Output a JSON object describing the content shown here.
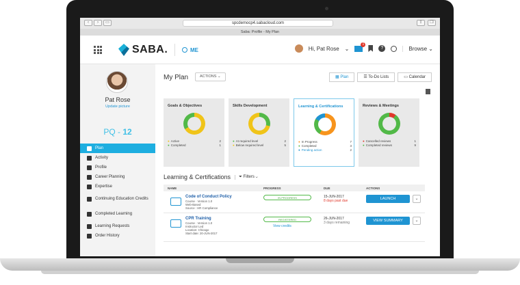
{
  "browser": {
    "url": "spcdemocp4.sabacloud.com",
    "tab_title": "Saba: Profile - My Plan"
  },
  "header": {
    "logo_text": "SABA.",
    "me_label": "ME",
    "greeting": "Hi, Pat Rose",
    "mail_count": "1",
    "browse_label": "Browse"
  },
  "sidebar": {
    "user_name": "Pat Rose",
    "update_picture": "Update picture",
    "pq_label": "PQ - ",
    "pq_value": "12",
    "items": [
      {
        "label": "Plan"
      },
      {
        "label": "Activity"
      },
      {
        "label": "Profile"
      },
      {
        "label": "Career Planning"
      },
      {
        "label": "Expertise"
      },
      {
        "label": "Continuing Education Credits"
      },
      {
        "label": "Completed Learning"
      },
      {
        "label": "Learning Requests"
      },
      {
        "label": "Order History"
      }
    ]
  },
  "main": {
    "title": "My Plan",
    "actions_label": "ACTIONS",
    "view_tabs": [
      {
        "label": "Plan"
      },
      {
        "label": "To-Do Lists"
      },
      {
        "label": "Calendar"
      }
    ],
    "cards": [
      {
        "title": "Goals & Objectives",
        "legend": [
          {
            "label": "Active",
            "value": "2",
            "color": "#f0c419"
          },
          {
            "label": "Completed",
            "value": "1",
            "color": "#52b948"
          }
        ]
      },
      {
        "title": "Skills Development",
        "legend": [
          {
            "label": "At required level",
            "value": "2",
            "color": "#52b948"
          },
          {
            "label": "Below required level",
            "value": "5",
            "color": "#f0c419"
          }
        ]
      },
      {
        "title": "Learning & Certifications",
        "legend": [
          {
            "label": "In Progress",
            "value": "7",
            "color": "#f7941d"
          },
          {
            "label": "Completed",
            "value": "3",
            "color": "#52b948"
          },
          {
            "label": "Pending action",
            "value": "2",
            "color": "#1f94d2"
          }
        ]
      },
      {
        "title": "Reviews & Meetings",
        "legend": [
          {
            "label": "Cancelled reviews",
            "value": "1",
            "color": "#e0382b"
          },
          {
            "label": "Completed reviews",
            "value": "9",
            "color": "#52b948"
          }
        ]
      }
    ],
    "section_title": "Learning & Certifications",
    "filters_label": "Filters",
    "table": {
      "headers": [
        "NAME",
        "PROGRESS",
        "DUE",
        "ACTIONS"
      ],
      "rows": [
        {
          "title": "Code of Conduct Policy",
          "line1": "Course · Version 1.0",
          "line2": "Web-Based",
          "line3": "Source : HR Compliance",
          "progress": "IN PROGRESS",
          "due_date": "15-JUN-2017",
          "due_note": "8 days past due",
          "action": "LAUNCH"
        },
        {
          "title": "CPR Training",
          "line1": "Course · Version 1.0",
          "line2": "Instructor Led",
          "line3": "Location: Chicago",
          "line4": "Start date: 20-JUN-2017",
          "progress": "REGISTERED",
          "credits": "View credits",
          "due_date": "26-JUN-2017",
          "due_note": "3 days remaining",
          "action": "VIEW SUMMARY"
        }
      ]
    }
  }
}
